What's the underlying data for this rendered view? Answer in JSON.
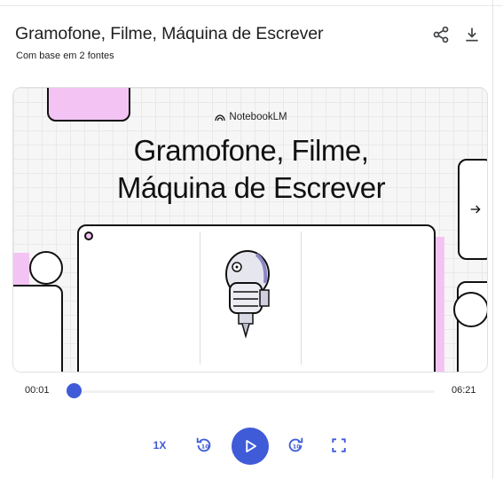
{
  "header": {
    "title": "Gramofone, Filme, Máquina de Escrever",
    "subtitle": "Com base em 2 fontes"
  },
  "actions": {
    "share_icon": "share-icon",
    "download_icon": "download-icon"
  },
  "slide": {
    "brand": "NotebookLM",
    "title_line1": "Gramofone, Filme,",
    "title_line2": "Máquina de Escrever",
    "next_icon": "arrow-right-icon"
  },
  "player": {
    "current_time": "00:01",
    "total_time": "06:21",
    "progress": 0.003,
    "speed": "1X",
    "rewind_icon": "replay-10-icon",
    "play_icon": "play-icon",
    "forward_icon": "forward-10-icon",
    "fullscreen_icon": "fullscreen-icon"
  },
  "colors": {
    "accent": "#3f5bd8",
    "pink": "#f3c4f3"
  }
}
